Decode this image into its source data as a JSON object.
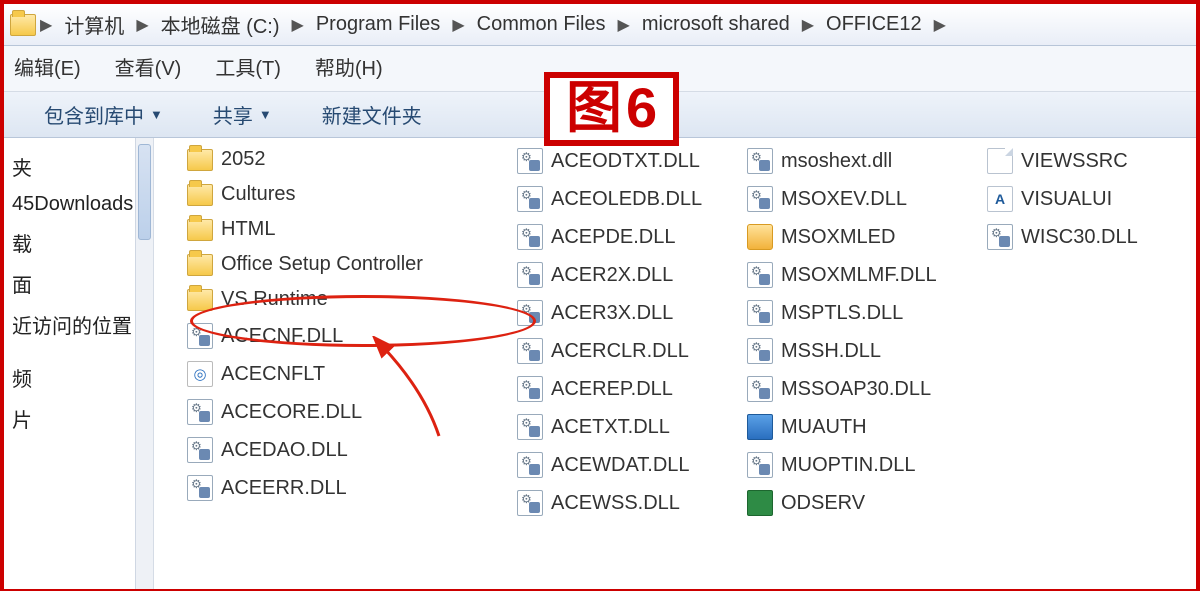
{
  "overlay": {
    "zh": "图",
    "num": "6"
  },
  "breadcrumb": [
    "计算机",
    "本地磁盘 (C:)",
    "Program Files",
    "Common Files",
    "microsoft shared",
    "OFFICE12"
  ],
  "menu": {
    "edit": "编辑(E)",
    "view": "查看(V)",
    "tools": "工具(T)",
    "help": "帮助(H)"
  },
  "toolbar": {
    "include": "包含到库中",
    "share": "共享",
    "newfolder": "新建文件夹"
  },
  "nav": [
    "夹",
    "45Downloads",
    "载",
    "面",
    "近访问的位置",
    "",
    "频",
    "片"
  ],
  "cols": [
    [
      {
        "t": "folder",
        "n": "2052"
      },
      {
        "t": "folder",
        "n": "Cultures"
      },
      {
        "t": "folder",
        "n": "HTML"
      },
      {
        "t": "folder",
        "n": "Office Setup Controller"
      },
      {
        "t": "folder",
        "n": "VS Runtime"
      },
      {
        "t": "dll",
        "n": "ACECNF.DLL"
      },
      {
        "t": "app",
        "n": "ACECNFLT"
      },
      {
        "t": "dll",
        "n": "ACECORE.DLL"
      },
      {
        "t": "dll",
        "n": "ACEDAO.DLL"
      },
      {
        "t": "dll",
        "n": "ACEERR.DLL"
      }
    ],
    [
      {
        "t": "dll",
        "n": "ACEODTXT.DLL"
      },
      {
        "t": "dll",
        "n": "ACEOLEDB.DLL"
      },
      {
        "t": "dll",
        "n": "ACEPDE.DLL"
      },
      {
        "t": "dll",
        "n": "ACER2X.DLL"
      },
      {
        "t": "dll",
        "n": "ACER3X.DLL"
      },
      {
        "t": "dll",
        "n": "ACERCLR.DLL"
      },
      {
        "t": "dll",
        "n": "ACEREP.DLL"
      },
      {
        "t": "dll",
        "n": "ACETXT.DLL"
      },
      {
        "t": "dll",
        "n": "ACEWDAT.DLL"
      },
      {
        "t": "dll",
        "n": "ACEWSS.DLL"
      }
    ],
    [
      {
        "t": "dll",
        "n": "msoshext.dll"
      },
      {
        "t": "dll",
        "n": "MSOXEV.DLL"
      },
      {
        "t": "special",
        "n": "MSOXMLED"
      },
      {
        "t": "dll",
        "n": "MSOXMLMF.DLL"
      },
      {
        "t": "dll",
        "n": "MSPTLS.DLL"
      },
      {
        "t": "dll",
        "n": "MSSH.DLL"
      },
      {
        "t": "dll",
        "n": "MSSOAP30.DLL"
      },
      {
        "t": "blue",
        "n": "MUAUTH"
      },
      {
        "t": "dll",
        "n": "MUOPTIN.DLL"
      },
      {
        "t": "green",
        "n": "ODSERV"
      }
    ],
    [
      {
        "t": "page",
        "n": "VIEWSSRC"
      },
      {
        "t": "afile",
        "n": "VISUALUI"
      },
      {
        "t": "dll",
        "n": "WISC30.DLL"
      }
    ]
  ]
}
